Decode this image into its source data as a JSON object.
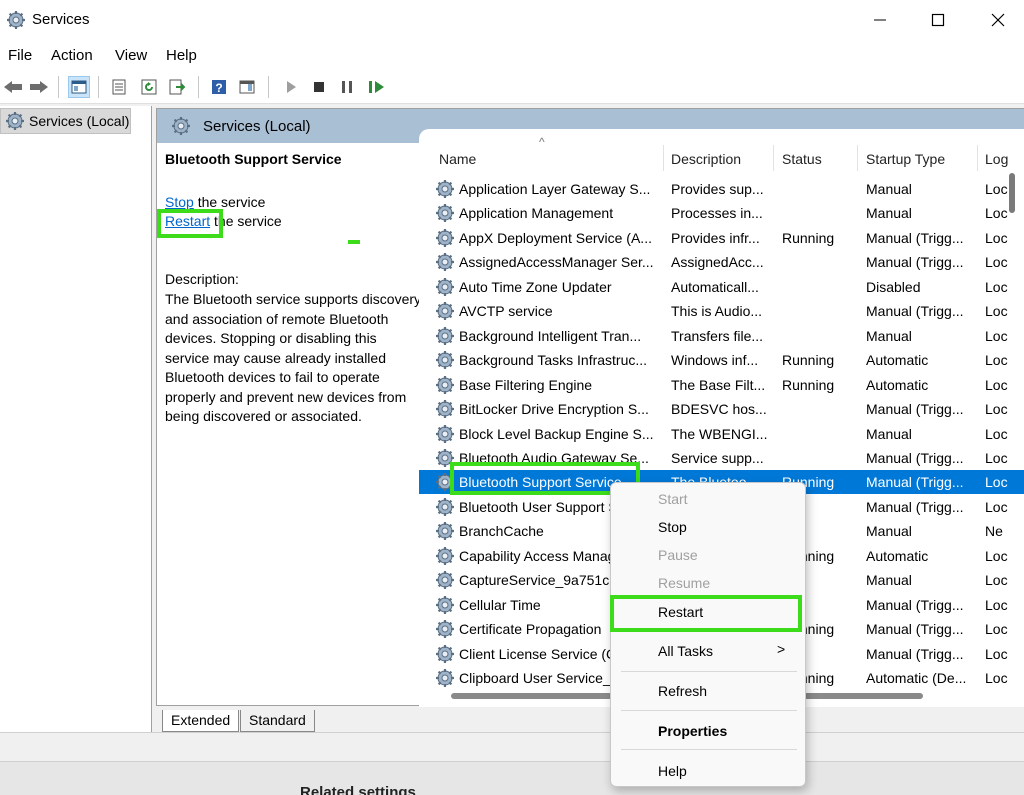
{
  "window": {
    "title": "Services"
  },
  "menu": [
    "File",
    "Action",
    "View",
    "Help"
  ],
  "tree": {
    "node_label": "Services (Local)"
  },
  "pane": {
    "header": "Services (Local)"
  },
  "details": {
    "service_title": "Bluetooth Support Service",
    "stop_link": "Stop",
    "stop_suffix": " the service",
    "restart_link": "Restart",
    "restart_suffix": " the service",
    "description_label": "Description:",
    "description": "The Bluetooth service supports discovery and association of remote Bluetooth devices.  Stopping or disabling this service may cause already installed Bluetooth devices to fail to operate properly and prevent new devices from being discovered or associated."
  },
  "columns": {
    "name": "Name",
    "description": "Description",
    "status": "Status",
    "startup": "Startup Type",
    "logon": "Log"
  },
  "rows": [
    {
      "name": "Application Layer Gateway S...",
      "description": "Provides sup...",
      "status": "",
      "startup": "Manual",
      "logon": "Loc"
    },
    {
      "name": "Application Management",
      "description": "Processes in...",
      "status": "",
      "startup": "Manual",
      "logon": "Loc"
    },
    {
      "name": "AppX Deployment Service (A...",
      "description": "Provides infr...",
      "status": "Running",
      "startup": "Manual (Trigg...",
      "logon": "Loc"
    },
    {
      "name": "AssignedAccessManager Ser...",
      "description": "AssignedAcc...",
      "status": "",
      "startup": "Manual (Trigg...",
      "logon": "Loc"
    },
    {
      "name": "Auto Time Zone Updater",
      "description": "Automaticall...",
      "status": "",
      "startup": "Disabled",
      "logon": "Loc"
    },
    {
      "name": "AVCTP service",
      "description": "This is Audio...",
      "status": "",
      "startup": "Manual (Trigg...",
      "logon": "Loc"
    },
    {
      "name": "Background Intelligent Tran...",
      "description": "Transfers file...",
      "status": "",
      "startup": "Manual",
      "logon": "Loc"
    },
    {
      "name": "Background Tasks Infrastruc...",
      "description": "Windows inf...",
      "status": "Running",
      "startup": "Automatic",
      "logon": "Loc"
    },
    {
      "name": "Base Filtering Engine",
      "description": "The Base Filt...",
      "status": "Running",
      "startup": "Automatic",
      "logon": "Loc"
    },
    {
      "name": "BitLocker Drive Encryption S...",
      "description": "BDESVC hos...",
      "status": "",
      "startup": "Manual (Trigg...",
      "logon": "Loc"
    },
    {
      "name": "Block Level Backup Engine S...",
      "description": "The WBENGI...",
      "status": "",
      "startup": "Manual",
      "logon": "Loc"
    },
    {
      "name": "Bluetooth Audio Gateway Se...",
      "description": "Service supp...",
      "status": "",
      "startup": "Manual (Trigg...",
      "logon": "Loc"
    },
    {
      "name": "Bluetooth Support Service",
      "description": "The Bluetoo...",
      "status": "Running",
      "startup": "Manual (Trigg...",
      "logon": "Loc"
    },
    {
      "name": "Bluetooth User Support Se...",
      "description": "",
      "status": "",
      "startup": "Manual (Trigg...",
      "logon": "Loc"
    },
    {
      "name": "BranchCache",
      "description": "",
      "status": "",
      "startup": "Manual",
      "logon": "Ne"
    },
    {
      "name": "Capability Access Manager...",
      "description": "",
      "status": "Running",
      "startup": "Automatic",
      "logon": "Loc"
    },
    {
      "name": "CaptureService_9a751c",
      "description": "",
      "status": "",
      "startup": "Manual",
      "logon": "Loc"
    },
    {
      "name": "Cellular Time",
      "description": "",
      "status": "",
      "startup": "Manual (Trigg...",
      "logon": "Loc"
    },
    {
      "name": "Certificate Propagation",
      "description": "",
      "status": "Running",
      "startup": "Manual (Trigg...",
      "logon": "Loc"
    },
    {
      "name": "Client License Service (C...",
      "description": "",
      "status": "",
      "startup": "Manual (Trigg...",
      "logon": "Loc"
    },
    {
      "name": "Clipboard User Service_9...",
      "description": "",
      "status": "Running",
      "startup": "Automatic (De...",
      "logon": "Loc"
    }
  ],
  "selected_row_index": 12,
  "context_menu": {
    "start": "Start",
    "stop": "Stop",
    "pause": "Pause",
    "resume": "Resume",
    "restart": "Restart",
    "all_tasks": "All Tasks",
    "all_tasks_arrow": ">",
    "refresh": "Refresh",
    "properties": "Properties",
    "help": "Help"
  },
  "tabs": {
    "extended": "Extended",
    "standard": "Standard"
  },
  "bottom": {
    "related_settings": "Related settings"
  },
  "colors": {
    "selection": "#0078d7",
    "highlight": "#3ddc1a",
    "pane_header": "#a9bfd4",
    "link": "#0066cc"
  }
}
